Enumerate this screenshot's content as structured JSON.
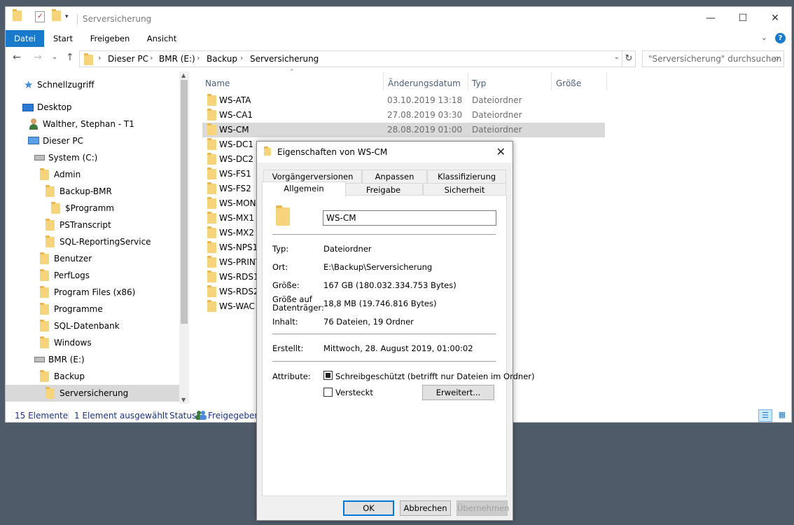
{
  "window": {
    "title": "Serversicherung",
    "min": "—",
    "max": "☐",
    "close": "✕"
  },
  "ribbon": {
    "tabs": [
      "Datei",
      "Start",
      "Freigeben",
      "Ansicht"
    ],
    "expand": "⌄",
    "help": "?"
  },
  "nav": {
    "back": "←",
    "forward": "→",
    "dropdown": "⌄",
    "up": "↑",
    "breadcrumb": [
      "Dieser PC",
      "BMR (E:)",
      "Backup",
      "Serversicherung"
    ],
    "crumb_sep": "›",
    "refresh": "↻",
    "search_placeholder": "\"Serversicherung\" durchsuchen",
    "search_icon": "⌕"
  },
  "tree": {
    "quick_access": "Schnellzugriff",
    "desktop": "Desktop",
    "user": "Walther, Stephan - T1",
    "this_pc": "Dieser PC",
    "system_drive": "System (C:)",
    "folders_c": [
      "Admin",
      "Backup-BMR",
      "$Programm",
      "PSTranscript",
      "SQL-ReportingService",
      "Benutzer",
      "PerfLogs",
      "Program Files (x86)",
      "Programme",
      "SQL-Datenbank",
      "Windows"
    ],
    "bmr_drive": "BMR (E:)",
    "backup": "Backup",
    "serversicherung": "Serversicherung"
  },
  "columns": {
    "name": "Name",
    "date": "Änderungsdatum",
    "type": "Typ",
    "size": "Größe"
  },
  "rows": [
    {
      "name": "WS-ATA",
      "date": "03.10.2019 13:18",
      "type": "Dateiordner"
    },
    {
      "name": "WS-CA1",
      "date": "27.08.2019 03:30",
      "type": "Dateiordner"
    },
    {
      "name": "WS-CM",
      "date": "28.08.2019 01:00",
      "type": "Dateiordner"
    },
    {
      "name": "WS-DC1",
      "date": "",
      "type": ""
    },
    {
      "name": "WS-DC2",
      "date": "",
      "type": ""
    },
    {
      "name": "WS-FS1",
      "date": "",
      "type": ""
    },
    {
      "name": "WS-FS2",
      "date": "",
      "type": ""
    },
    {
      "name": "WS-MON",
      "date": "",
      "type": ""
    },
    {
      "name": "WS-MX1",
      "date": "",
      "type": ""
    },
    {
      "name": "WS-MX2",
      "date": "",
      "type": ""
    },
    {
      "name": "WS-NPS1",
      "date": "",
      "type": ""
    },
    {
      "name": "WS-PRINT",
      "date": "",
      "type": ""
    },
    {
      "name": "WS-RDS1",
      "date": "",
      "type": ""
    },
    {
      "name": "WS-RDS2",
      "date": "",
      "type": ""
    },
    {
      "name": "WS-WAC",
      "date": "",
      "type": ""
    }
  ],
  "status": {
    "count": "15 Elemente",
    "selected": "1 Element ausgewählt",
    "state_label": "Status:",
    "state_value": "Freigegeben",
    "details_view": "☰",
    "tiles_view": "▦"
  },
  "dialog": {
    "title": "Eigenschaften von WS-CM",
    "close": "✕",
    "tabs_row1": [
      "Vorgängerversionen",
      "Anpassen",
      "Klassifizierung"
    ],
    "tabs_row2": [
      "Allgemein",
      "Freigabe",
      "Sicherheit"
    ],
    "name_value": "WS-CM",
    "props": {
      "type_label": "Typ:",
      "type_value": "Dateiordner",
      "location_label": "Ort:",
      "location_value": "E:\\Backup\\Serversicherung",
      "size_label": "Größe:",
      "size_value": "167 GB (180.032.334.753 Bytes)",
      "disk_label": "Größe auf Datenträger:",
      "disk_value": "18,8 MB (19.746.816 Bytes)",
      "contents_label": "Inhalt:",
      "contents_value": "76 Dateien, 19 Ordner",
      "created_label": "Erstellt:",
      "created_value": "Mittwoch, 28. August 2019, 01:00:02",
      "attributes_label": "Attribute:",
      "readonly_label": "Schreibgeschützt (betrifft nur Dateien im Ordner)",
      "readonly_checked": true,
      "hidden_label": "Versteckt",
      "hidden_checked": false,
      "advanced_button": "Erweitert..."
    },
    "buttons": {
      "ok": "OK",
      "cancel": "Abbrechen",
      "apply": "Übernehmen"
    }
  }
}
